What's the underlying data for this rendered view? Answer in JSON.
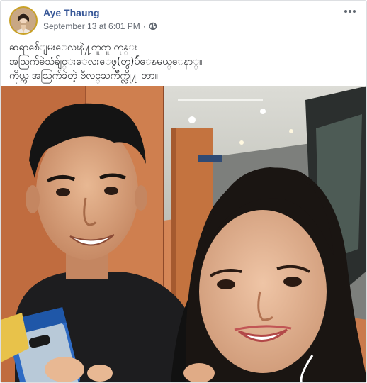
{
  "post": {
    "author": "Aye Thaung",
    "timestamp": "September 13 at 6:01 PM",
    "separator": "·",
    "privacy_icon": "globe-icon",
    "more_icon": "more-options-icon",
    "text_lines": [
      "ဆရာစ်ေျမးေလးနဲ႔တူတူ တုန္း",
      "အသြက်ခဲသံခ်ျင္းေလးေဖွ(တွ)ပ်ဴေနမယ္ေနာ္။",
      "ကိုယ္က အသြက်ခဲတဲ့ ဗီလင္ႀကိဳက္လို႔ ဘာ။"
    ]
  },
  "colors": {
    "author_blue": "#385898",
    "meta_gray": "#616770",
    "border": "#dddfe2",
    "avatar_ring": "#c9a227"
  }
}
